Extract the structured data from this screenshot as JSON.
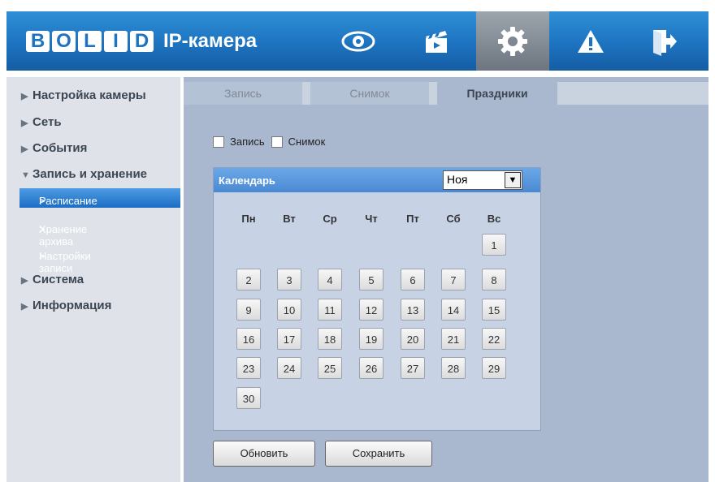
{
  "header": {
    "logo_letters": [
      "B",
      "O",
      "L",
      "I",
      "D"
    ],
    "logo_text": "BOLID",
    "title": "IP-камера",
    "nav": [
      {
        "icon": "eye-icon",
        "label": "Просмотр"
      },
      {
        "icon": "clapperboard-icon",
        "label": "Воспроизведение"
      },
      {
        "icon": "gear-icon",
        "label": "Настройки",
        "active": true
      },
      {
        "icon": "warning-icon",
        "label": "Тревога"
      },
      {
        "icon": "exit-icon",
        "label": "Выход"
      }
    ]
  },
  "sidebar": {
    "items": [
      {
        "label": "Настройка камеры"
      },
      {
        "label": "Сеть"
      },
      {
        "label": "События"
      },
      {
        "label": "Запись и хранение",
        "expanded": true
      },
      {
        "label": "Система"
      },
      {
        "label": "Информация"
      }
    ],
    "subitems": [
      {
        "label": "Расписание",
        "active": true
      },
      {
        "label": "Хранение архива"
      },
      {
        "label": "Настройки записи"
      }
    ]
  },
  "tabs": [
    {
      "label": "Запись"
    },
    {
      "label": "Снимок"
    },
    {
      "label": "Праздники",
      "active": true
    }
  ],
  "checkboxes": {
    "record_label": "Запись",
    "snapshot_label": "Снимок"
  },
  "calendar": {
    "title": "Календарь",
    "month": "Ноя",
    "weekdays": [
      "Пн",
      "Вт",
      "Ср",
      "Чт",
      "Пт",
      "Сб",
      "Вс"
    ],
    "days": [
      "1",
      "2",
      "3",
      "4",
      "5",
      "6",
      "7",
      "8",
      "9",
      "10",
      "11",
      "12",
      "13",
      "14",
      "15",
      "16",
      "17",
      "18",
      "19",
      "20",
      "21",
      "22",
      "23",
      "24",
      "25",
      "26",
      "27",
      "28",
      "29",
      "30"
    ]
  },
  "buttons": {
    "refresh": "Обновить",
    "save": "Сохранить"
  },
  "colors": {
    "header_blue": "#1d73c0",
    "active_item": "#2a7ad3",
    "panel_bg": "#a9b8ce"
  }
}
